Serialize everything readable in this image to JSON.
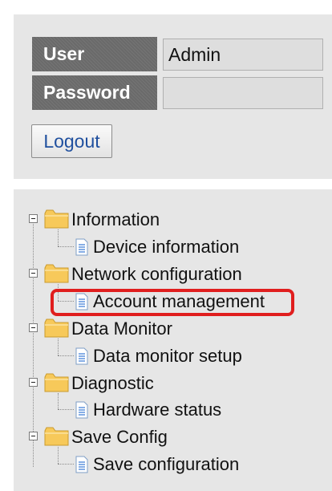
{
  "login": {
    "user_label": "User",
    "user_value": "Admin",
    "password_label": "Password",
    "password_value": "",
    "logout_label": "Logout"
  },
  "tree": {
    "sections": [
      {
        "label": "Information",
        "icon": "folder-icon",
        "child": {
          "label": "Device information",
          "icon": "document-icon"
        }
      },
      {
        "label": "Network configuration",
        "icon": "folder-icon",
        "child": {
          "label": "Account management",
          "icon": "document-icon"
        }
      },
      {
        "label": "Data Monitor",
        "icon": "folder-icon",
        "child": {
          "label": "Data monitor setup",
          "icon": "document-icon"
        }
      },
      {
        "label": "Diagnostic",
        "icon": "folder-icon",
        "child": {
          "label": "Hardware status",
          "icon": "document-icon"
        }
      },
      {
        "label": "Save Config",
        "icon": "folder-icon",
        "child": {
          "label": "Save configuration",
          "icon": "document-icon"
        }
      }
    ],
    "highlighted_item": "Account management"
  },
  "colors": {
    "panel_bg": "#e6e6e6",
    "label_bg": "#6a6a6a",
    "highlight": "#e01e1e",
    "link_blue": "#1f4f9e",
    "folder": "#f7c95a"
  }
}
